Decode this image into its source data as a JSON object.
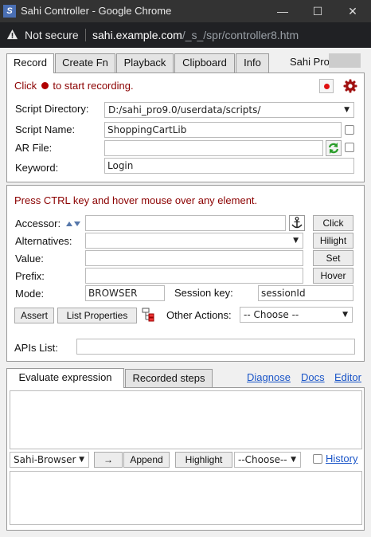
{
  "window": {
    "title": "Sahi Controller - Google Chrome",
    "app_icon": "S"
  },
  "address": {
    "security": "Not secure",
    "host": "sahi.example.com",
    "path": "/_s_/spr/controller8.htm"
  },
  "tabs": [
    "Record",
    "Create Fn",
    "Playback",
    "Clipboard",
    "Info"
  ],
  "brand": "Sahi Pro",
  "record": {
    "click_prefix": "Click",
    "click_suffix": "to start recording.",
    "script_dir_label": "Script Directory:",
    "script_dir_value": "D:/sahi_pro9.0/userdata/scripts/",
    "script_name_label": "Script Name:",
    "script_name_value": "ShoppingCartLib",
    "ar_file_label": "AR File:",
    "ar_file_value": "",
    "keyword_label": "Keyword:",
    "keyword_value": "Login"
  },
  "accessor": {
    "hint": "Press CTRL key and hover mouse over any element.",
    "accessor_label": "Accessor:",
    "accessor_value": "",
    "alternatives_label": "Alternatives:",
    "value_label": "Value:",
    "prefix_label": "Prefix:",
    "mode_label": "Mode:",
    "mode_value": "BROWSER",
    "session_label": "Session key:",
    "session_value": "sessionId",
    "click_btn": "Click",
    "hilight_btn": "Hilight",
    "set_btn": "Set",
    "hover_btn": "Hover",
    "assert_btn": "Assert",
    "list_props_btn": "List Properties",
    "other_actions_label": "Other Actions:",
    "other_actions_value": "-- Choose --",
    "apis_label": "APIs List:"
  },
  "bottom": {
    "tab_eval": "Evaluate expression",
    "tab_steps": "Recorded steps",
    "diagnose": "Diagnose",
    "docs": "Docs",
    "editor": "Editor",
    "browser_select": "Sahi-Browser",
    "arrow_btn": "→",
    "append_btn": "Append",
    "highlight_btn": "Highlight",
    "choose_select": "--Choose--",
    "history": "History"
  },
  "colors": {
    "accent_red": "#8b0000",
    "link_blue": "#1a55c8"
  }
}
